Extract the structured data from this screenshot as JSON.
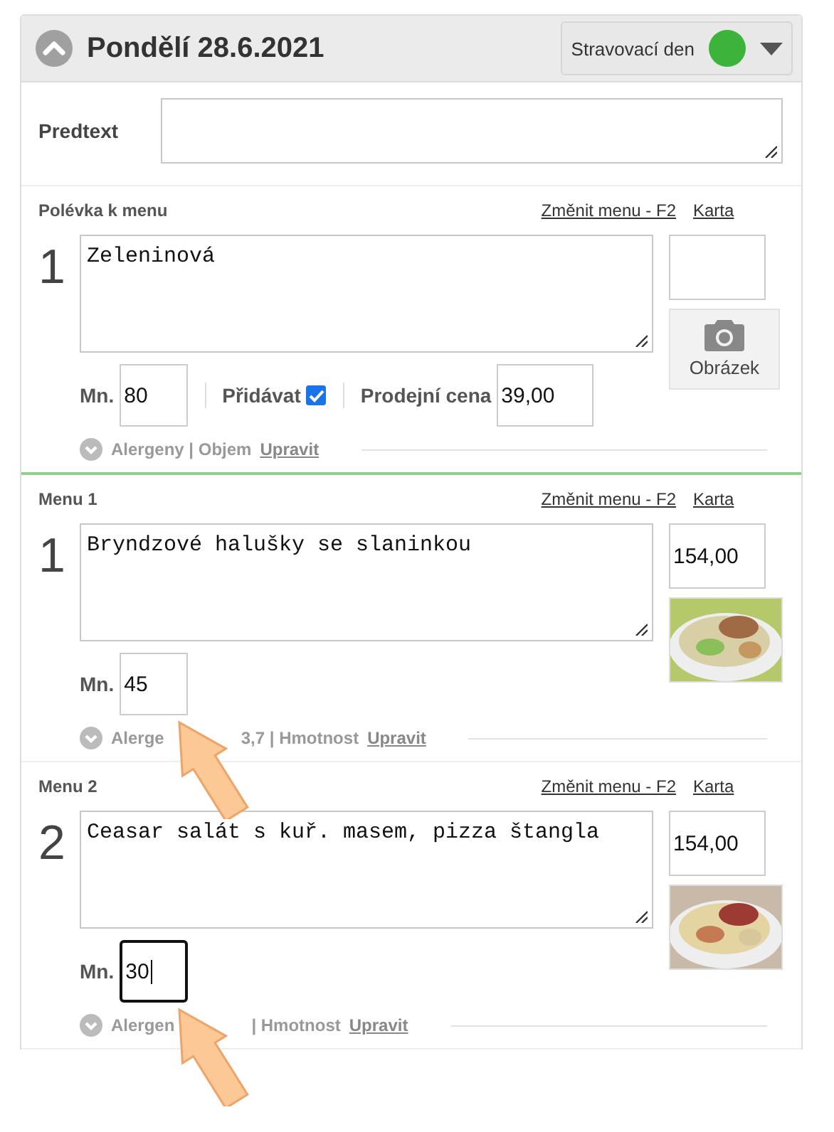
{
  "header": {
    "title": "Pondělí 28.6.2021",
    "expanded": true,
    "day_type": {
      "label": "Stravovací den",
      "color": "#3cb43c"
    }
  },
  "predtext": {
    "label": "Predtext"
  },
  "sections": [
    {
      "kind": "soup",
      "title": "Polévka k menu",
      "change_link": "Změnit menu - F2",
      "card_link": "Karta",
      "number": "1",
      "dish": "Zeleninová",
      "qty_label": "Mn.",
      "qty": "80",
      "qty_focused": false,
      "add_label": "Přidávat",
      "add_checked": true,
      "price_label": "Prodejní cena",
      "price": "39,00",
      "photo_button": "Obrázek",
      "info": [
        "Alergeny | Objem"
      ],
      "edit_link": "Upravit",
      "annotated": false
    },
    {
      "kind": "menu",
      "title": "Menu 1",
      "change_link": "Změnit menu - F2",
      "card_link": "Karta",
      "number": "1",
      "dish": "Bryndzové halušky se slaninkou",
      "card_price": "154,00",
      "qty_label": "Mn.",
      "qty": "45",
      "qty_focused": false,
      "info": [
        "Alerge",
        "3,7 | Hmotnost"
      ],
      "edit_link": "Upravit",
      "annotated": true
    },
    {
      "kind": "menu",
      "title": "Menu 2",
      "change_link": "Změnit menu - F2",
      "card_link": "Karta",
      "number": "2",
      "dish": "Ceasar salát s kuř. masem, pizza štangla",
      "card_price": "154,00",
      "qty_label": "Mn.",
      "qty": "30",
      "qty_focused": true,
      "info": [
        "Alergen",
        "| Hmotnost"
      ],
      "edit_link": "Upravit",
      "annotated": true
    }
  ]
}
